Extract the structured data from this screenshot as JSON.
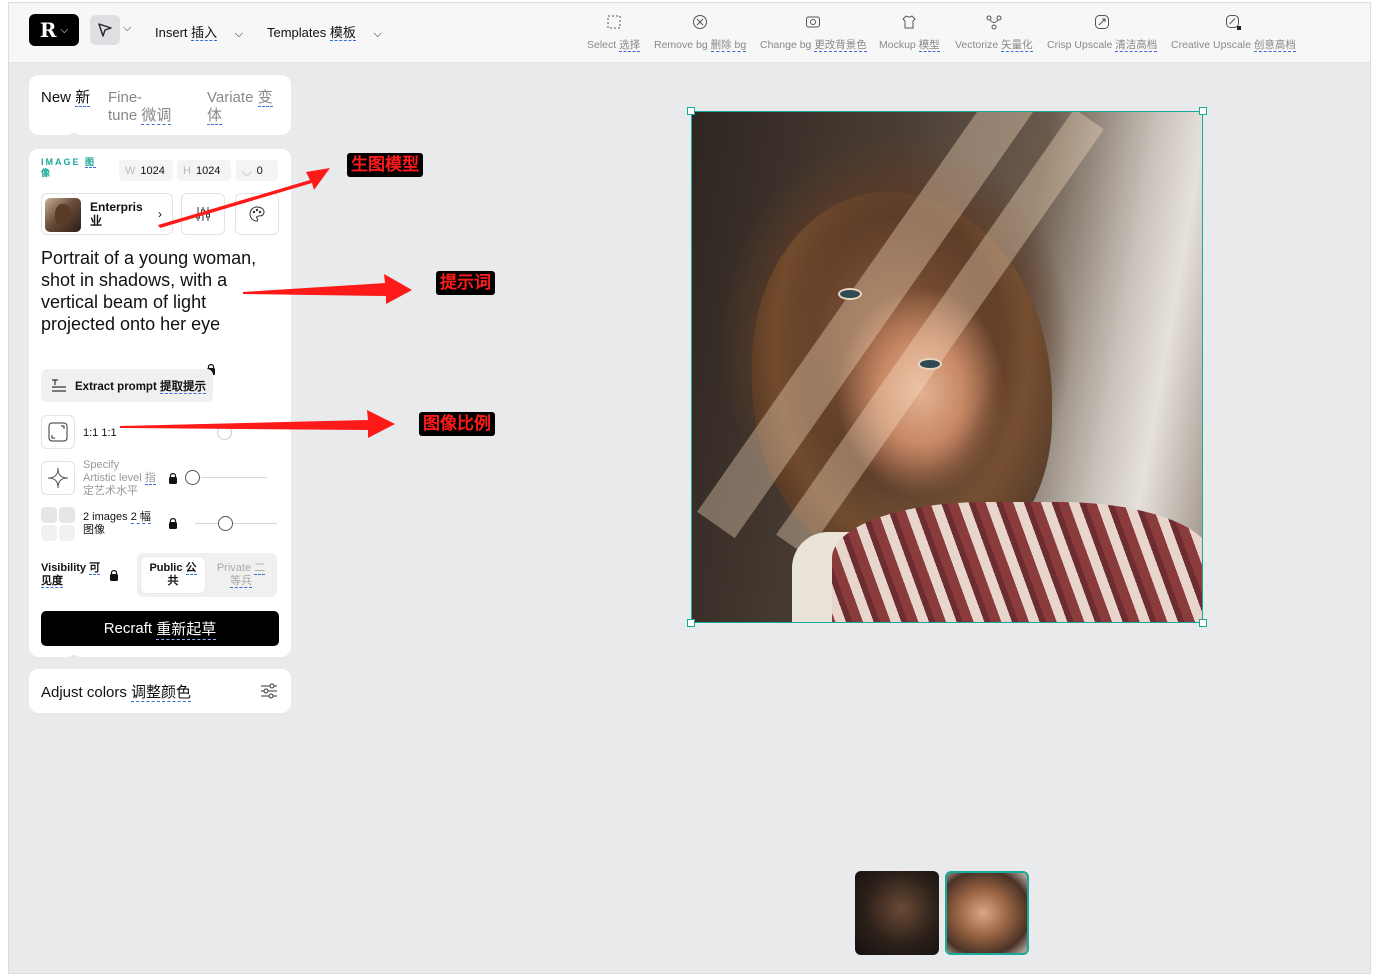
{
  "topbar": {
    "insert_label": "Insert",
    "insert_label_cn": "插入",
    "templates_label": "Templates",
    "templates_label_cn": "模板",
    "tools": [
      {
        "label": "Select",
        "cn": "选择",
        "icon": "select-icon"
      },
      {
        "label": "Remove bg",
        "cn": "删除 bg",
        "icon": "remove-bg-icon"
      },
      {
        "label": "Change bg",
        "cn": "更改背景色",
        "icon": "change-bg-icon"
      },
      {
        "label": "Mockup",
        "cn": "模型",
        "icon": "mockup-icon"
      },
      {
        "label": "Vectorize",
        "cn": "矢量化",
        "icon": "vectorize-icon"
      },
      {
        "label": "Crisp Upscale",
        "cn": "清洁高档",
        "icon": "crisp-upscale-icon"
      },
      {
        "label": "Creative Upscale",
        "cn": "创意高档",
        "icon": "creative-upscale-icon"
      }
    ]
  },
  "tabs": {
    "new": "New",
    "new_cn": "新",
    "finetune_1": "Fine-",
    "finetune_2": "tune",
    "finetune_cn": "微调",
    "variate": "Variate",
    "variate_cn_1": "变",
    "variate_cn_2": "体"
  },
  "settings": {
    "image_label": "IMAGE",
    "image_label_cn_1": "图",
    "image_label_cn_2": "像",
    "w_key": "W",
    "width": "1024",
    "h_key": "H",
    "height": "1024",
    "seed": "0",
    "model_name_1": "Enterpris",
    "model_name_2": "业",
    "prompt": "Portrait of a young woman, shot in shadows, with a vertical beam of light projected onto her eye",
    "extract_label": "Extract prompt",
    "extract_cn": "提取提示",
    "ratio_label": "1:1 1:1",
    "artistic_1": "Specify",
    "artistic_2": "Artistic level",
    "artistic_cn_1": "指",
    "artistic_cn_2": "定艺术水平",
    "images_label": "2 images",
    "images_cn_1": "2 幅",
    "images_cn_2": "图像",
    "visibility_label": "Visibility",
    "visibility_cn_1": "可",
    "visibility_cn_2": "见度",
    "public_label": "Public",
    "public_cn_1": "公",
    "public_cn_2": "共",
    "private_label": "Private",
    "private_cn_1": "二",
    "private_cn_2": "等兵",
    "recraft_label": "Recraft",
    "recraft_cn": "重新起草"
  },
  "adjust": {
    "label": "Adjust colors",
    "cn": "调整颜色"
  },
  "annotations": {
    "model": "生图模型",
    "prompt": "提示词",
    "ratio": "图像比例"
  },
  "colors": {
    "accent": "#1aa99a",
    "annotation": "#ff1a1a",
    "link_dash": "#3b6fd8"
  }
}
